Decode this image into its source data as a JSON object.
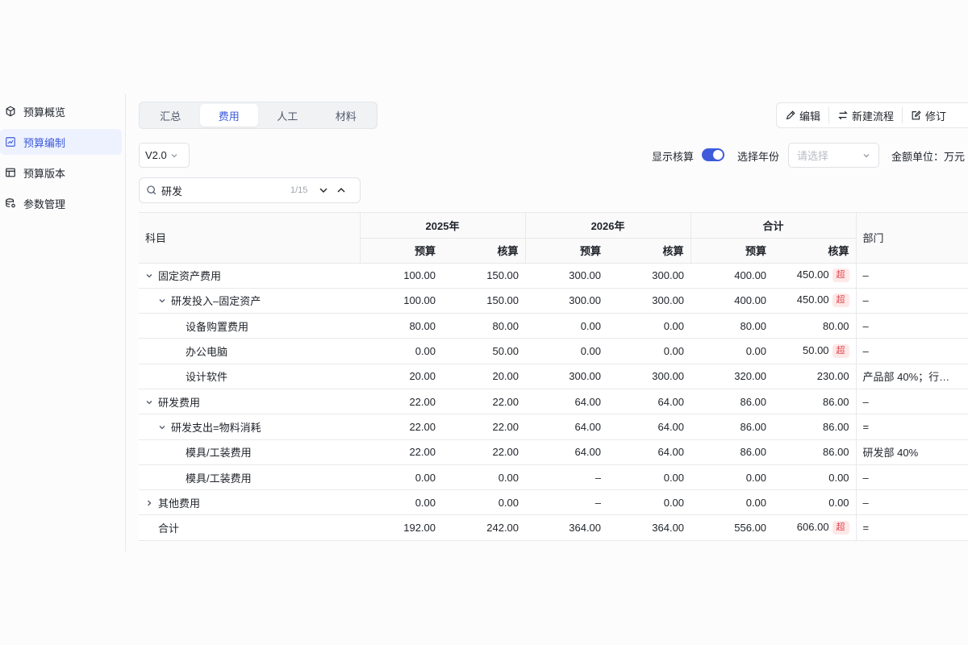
{
  "sidebar": {
    "items": [
      {
        "label": "预算概览",
        "icon": "cube-icon",
        "active": false
      },
      {
        "label": "预算编制",
        "icon": "chart-icon",
        "active": true
      },
      {
        "label": "预算版本",
        "icon": "table-icon",
        "active": false
      },
      {
        "label": "参数管理",
        "icon": "database-icon",
        "active": false
      }
    ]
  },
  "tabs": [
    {
      "label": "汇总",
      "active": false
    },
    {
      "label": "费用",
      "active": true
    },
    {
      "label": "人工",
      "active": false
    },
    {
      "label": "材料",
      "active": false
    }
  ],
  "actions": {
    "edit": "编辑",
    "new_flow": "新建流程",
    "revise": "修订"
  },
  "version": {
    "value": "V2.0"
  },
  "filters": {
    "show_audit_label": "显示核算",
    "show_audit_on": true,
    "year_label": "选择年份",
    "year_placeholder": "请选择",
    "unit_label": "金额单位：万元"
  },
  "search": {
    "value": "研发",
    "count": "1/15"
  },
  "table": {
    "subject_header": "科目",
    "dept_header": "部门",
    "groups": [
      "2025年",
      "2026年",
      "合计"
    ],
    "sub_headers": [
      "预算",
      "核算"
    ],
    "over_label": "超",
    "rows": [
      {
        "name": "固定资产费用",
        "level": 1,
        "arrow": "down",
        "v": [
          "100.00",
          "150.00",
          "300.00",
          "300.00",
          "400.00",
          "450.00"
        ],
        "over": true,
        "dept": "–"
      },
      {
        "name": "研发投入–固定资产",
        "level": 2,
        "arrow": "down",
        "v": [
          "100.00",
          "150.00",
          "300.00",
          "300.00",
          "400.00",
          "450.00"
        ],
        "over": true,
        "dept": "–"
      },
      {
        "name": "设备购置费用",
        "level": 3,
        "arrow": "",
        "v": [
          "80.00",
          "80.00",
          "0.00",
          "0.00",
          "80.00",
          "80.00"
        ],
        "over": false,
        "dept": "–"
      },
      {
        "name": "办公电脑",
        "level": 3,
        "arrow": "",
        "v": [
          "0.00",
          "50.00",
          "0.00",
          "0.00",
          "0.00",
          "50.00"
        ],
        "over": true,
        "dept": "–"
      },
      {
        "name": "设计软件",
        "level": 3,
        "arrow": "",
        "v": [
          "20.00",
          "20.00",
          "300.00",
          "300.00",
          "320.00",
          "230.00"
        ],
        "over": false,
        "dept": "产品部 40%；行…"
      },
      {
        "name": "研发费用",
        "level": 1,
        "arrow": "down",
        "v": [
          "22.00",
          "22.00",
          "64.00",
          "64.00",
          "86.00",
          "86.00"
        ],
        "over": false,
        "dept": "–"
      },
      {
        "name": "研发支出=物料消耗",
        "level": 2,
        "arrow": "down",
        "v": [
          "22.00",
          "22.00",
          "64.00",
          "64.00",
          "86.00",
          "86.00"
        ],
        "over": false,
        "dept": "="
      },
      {
        "name": "模具/工装费用",
        "level": 3,
        "arrow": "",
        "v": [
          "22.00",
          "22.00",
          "64.00",
          "64.00",
          "86.00",
          "86.00"
        ],
        "over": false,
        "dept": "研发部 40%"
      },
      {
        "name": "模具/工装费用",
        "level": 3,
        "arrow": "",
        "v": [
          "0.00",
          "0.00",
          "–",
          "0.00",
          "0.00",
          "0.00"
        ],
        "over": false,
        "dept": "–"
      },
      {
        "name": "其他费用",
        "level": 1,
        "arrow": "right",
        "v": [
          "0.00",
          "0.00",
          "–",
          "0.00",
          "0.00",
          "0.00"
        ],
        "over": false,
        "dept": "–"
      },
      {
        "name": "合计",
        "level": 1,
        "arrow": "none",
        "v": [
          "192.00",
          "242.00",
          "364.00",
          "364.00",
          "556.00",
          "606.00"
        ],
        "over": true,
        "dept": "="
      }
    ]
  },
  "colors": {
    "accent": "#3d5bdb",
    "over_bg": "#fde8e8",
    "over_text": "#e0484f"
  }
}
